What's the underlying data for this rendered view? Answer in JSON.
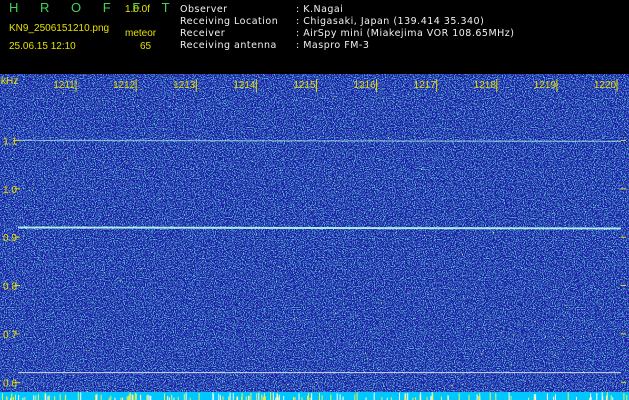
{
  "header": {
    "app_title": "H R O F F T",
    "version": "1.0.0f",
    "filename": "KN9_2506151210.png",
    "mode": "meteor",
    "datetime": "25.06.15 12:10",
    "count": "65",
    "info": [
      {
        "label": "Observer",
        "value": ": K.Nagai"
      },
      {
        "label": "Receiving Location",
        "value": ": Chigasaki, Japan (139.414 35.340)"
      },
      {
        "label": "Receiver",
        "value": ": AirSpy mini (Miakejima VOR 108.65MHz)"
      },
      {
        "label": "Receiving antenna",
        "value": ": Maspro FM-3"
      }
    ]
  },
  "axes": {
    "y_unit": "kHz",
    "y_ticks": [
      "1.1",
      "1.0",
      "0.9",
      "0.8",
      "0.7",
      "0.6"
    ],
    "x_ticks": [
      "1211",
      "1212",
      "1213",
      "1214",
      "1215",
      "1216",
      "1217",
      "1218",
      "1219",
      "1220"
    ]
  },
  "spectrogram": {
    "y_range_khz": [
      0.58,
      1.2
    ],
    "carriers_khz": [
      0.92,
      1.1
    ],
    "reference_line_khz": 0.62,
    "colors": {
      "background": "#1a1ea8",
      "text": "#e8e000",
      "carrier": "#b8fff0",
      "baseline": "#00c8ff"
    }
  }
}
